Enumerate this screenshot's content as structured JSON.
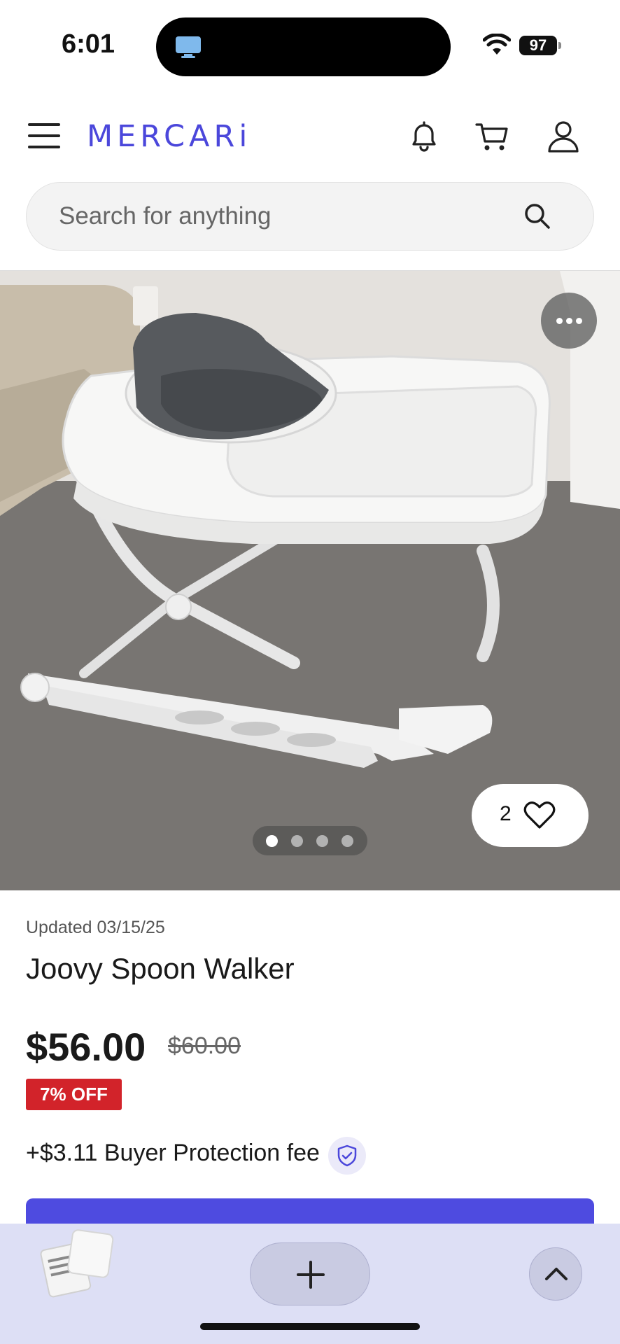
{
  "status_bar": {
    "time": "6:01",
    "battery": "97"
  },
  "header": {
    "logo": "MERCARi",
    "icons": [
      "menu-icon",
      "bell-icon",
      "cart-icon",
      "user-icon"
    ]
  },
  "search": {
    "placeholder": "Search for anything"
  },
  "gallery": {
    "like_count": "2",
    "image_count": 4,
    "active_image": 1
  },
  "item": {
    "updated": "Updated 03/15/25",
    "title": "Joovy Spoon Walker",
    "price": "$56.00",
    "original_price": "$60.00",
    "discount": "7% OFF",
    "buyer_fee": "+$3.11 Buyer Protection fee"
  },
  "colors": {
    "brand": "#4b47db",
    "discount_badge": "#d2232a",
    "buy_button": "#4e4be0",
    "bottom_bar": "#dddff5"
  }
}
